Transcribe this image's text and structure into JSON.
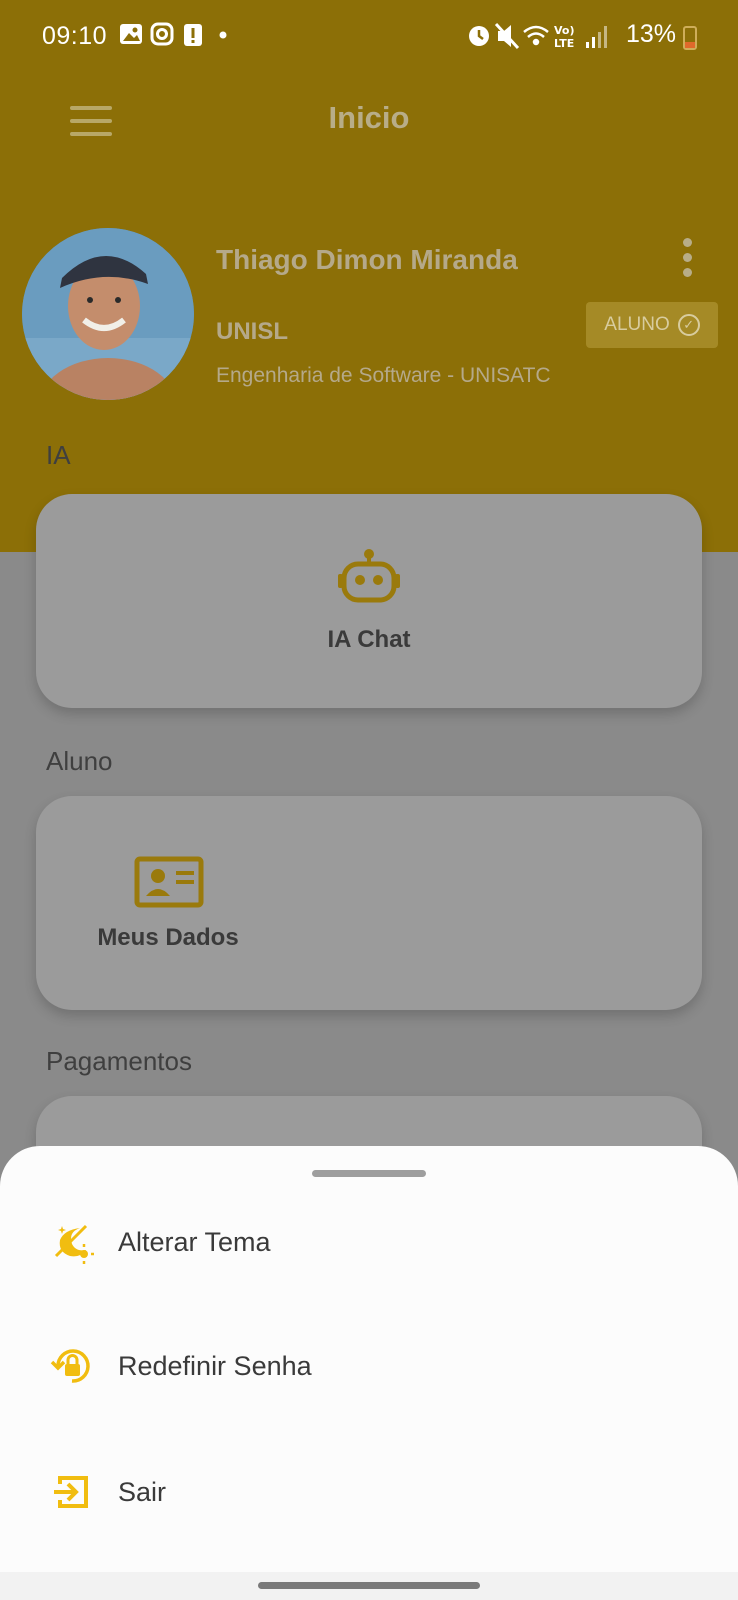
{
  "status_bar": {
    "time": "09:10",
    "left_icons": [
      "gallery-icon",
      "instagram-icon",
      "alert-icon",
      "dot-icon"
    ],
    "right_icons": [
      "alarm-icon",
      "mute-icon",
      "wifi-icon",
      "volte-icon",
      "signal-icon"
    ],
    "battery": "13%"
  },
  "app_bar": {
    "title": "Inicio",
    "menu_icon": "hamburger-menu-icon"
  },
  "profile": {
    "name": "Thiago Dimon Miranda",
    "institution": "UNISL",
    "course": "Engenharia de Software - UNISATC",
    "role_badge": "ALUNO",
    "more_icon": "more-vertical-icon"
  },
  "sections": [
    {
      "title": "IA",
      "card_label": "IA Chat",
      "icon": "robot-icon"
    },
    {
      "title": "Aluno",
      "card_label": "Meus Dados",
      "icon": "id-card-icon"
    },
    {
      "title": "Pagamentos"
    }
  ],
  "bottom_sheet": {
    "items": [
      {
        "label": "Alterar Tema",
        "icon": "theme-icon"
      },
      {
        "label": "Redefinir Senha",
        "icon": "lock-reset-icon"
      },
      {
        "label": "Sair",
        "icon": "logout-icon"
      }
    ]
  },
  "colors": {
    "accent": "#f1bd10",
    "header_dimmed": "#8c6f07",
    "sheet_bg": "#fcfcfc"
  }
}
